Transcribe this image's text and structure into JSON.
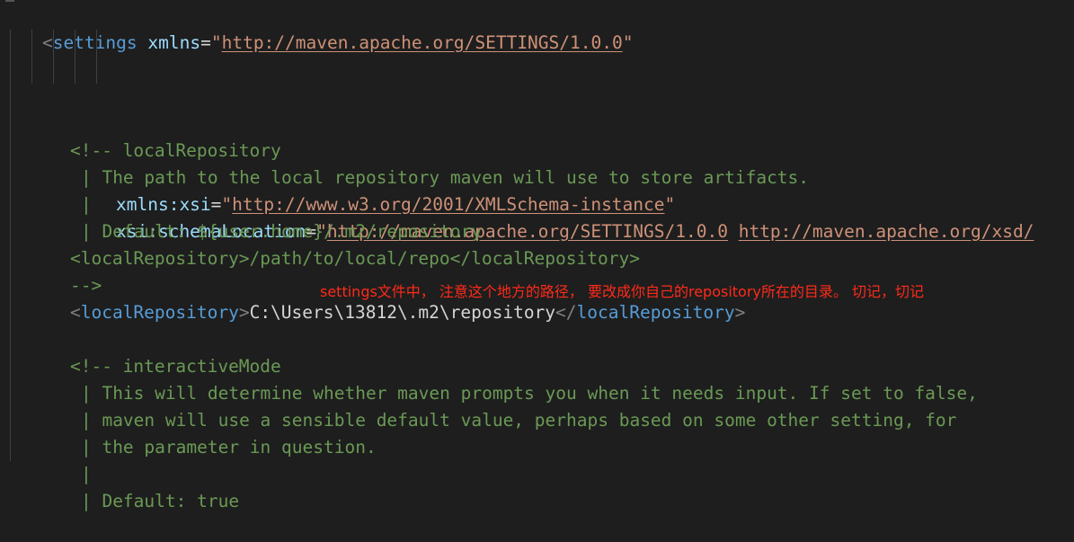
{
  "lines": {
    "l1": {
      "open": "<",
      "tag": "settings",
      "attr": "xmlns",
      "eq": "=",
      "q1": "\"",
      "url": "http://maven.apache.org/SETTINGS/1.0.0",
      "q2": "\""
    },
    "l2": {
      "attr": "xmlns:xsi",
      "eq": "=",
      "q1": "\"",
      "url": "http://www.w3.org/2001/XMLSchema-instance",
      "q2": "\""
    },
    "l3": {
      "attr": "xsi:schemaLocation",
      "eq": "=",
      "q1": "\"",
      "url1": "http://maven.apache.org/SETTINGS/1.0.0",
      "sp": " ",
      "url2": "http://maven.apache.org/xsd/"
    },
    "l4": "<!-- localRepository",
    "l5": "| The path to the local repository maven will use to store artifacts.",
    "l6": "|",
    "l7": "| Default: ${user.home}/.m2/repository",
    "l8": "<localRepository>/path/to/local/repo</localRepository>",
    "l9": "-->",
    "l10": {
      "open": "<",
      "tag": "localRepository",
      "close": ">",
      "value": "C:\\Users\\13812\\.m2\\repository",
      "open2": "</",
      "tag2": "localRepository",
      "close2": ">"
    },
    "l12": "<!-- interactiveMode",
    "l13": "| This will determine whether maven prompts you when it needs input. If set to false,",
    "l14": "| maven will use a sensible default value, perhaps based on some other setting, for",
    "l15": "| the parameter in question.",
    "l16": "|",
    "l17": "| Default: true"
  },
  "annotation": "settings文件中， 注意这个地方的路径， 要改成你自己的repository所在的目录。 切记，切记"
}
